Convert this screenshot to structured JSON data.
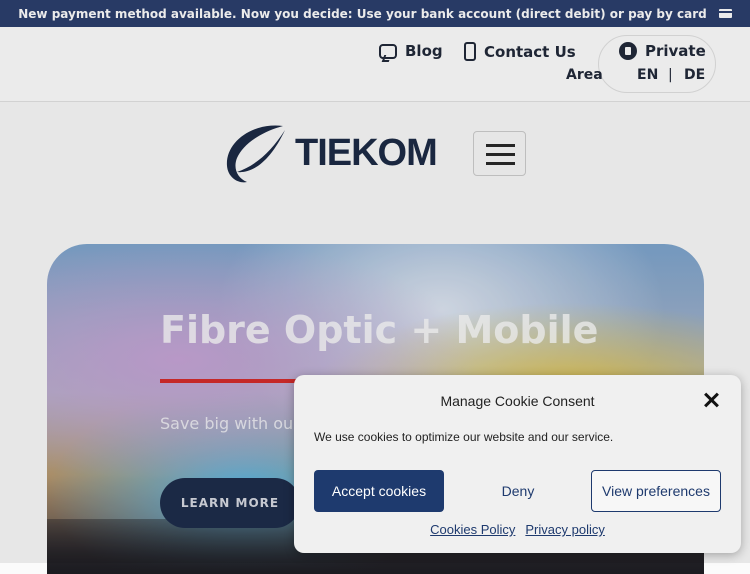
{
  "banner": {
    "text": "New payment method available. Now you decide: Use your bank account (direct debit) or pay by card",
    "icon": "credit-card-icon"
  },
  "topnav": {
    "blog": {
      "label": "Blog",
      "icon": "chat-bubble-icon"
    },
    "contact": {
      "label": "Contact Us",
      "icon": "phone-icon"
    },
    "private_area": {
      "label_line1": "Private",
      "label_line2": "Area",
      "icon": "lock-icon"
    },
    "languages": [
      "EN",
      "DE"
    ],
    "lang_separator": "|"
  },
  "header": {
    "logo_text": "TIEKOM",
    "menu_icon": "hamburger-menu-icon"
  },
  "hero": {
    "title": "Fibre Optic + Mobile",
    "subtitle": "Save big with our",
    "button_label": "LEARN MORE"
  },
  "cookie_dialog": {
    "title": "Manage Cookie Consent",
    "message": "We use cookies to optimize our website and our service.",
    "accept_label": "Accept cookies",
    "deny_label": "Deny",
    "preferences_label": "View preferences",
    "cookies_policy_label": "Cookies Policy",
    "privacy_policy_label": "Privacy policy"
  },
  "colors": {
    "brand_navy": "#1e3a6e",
    "banner_bg": "#2c3f6e",
    "accent_red": "#d62c2c"
  }
}
